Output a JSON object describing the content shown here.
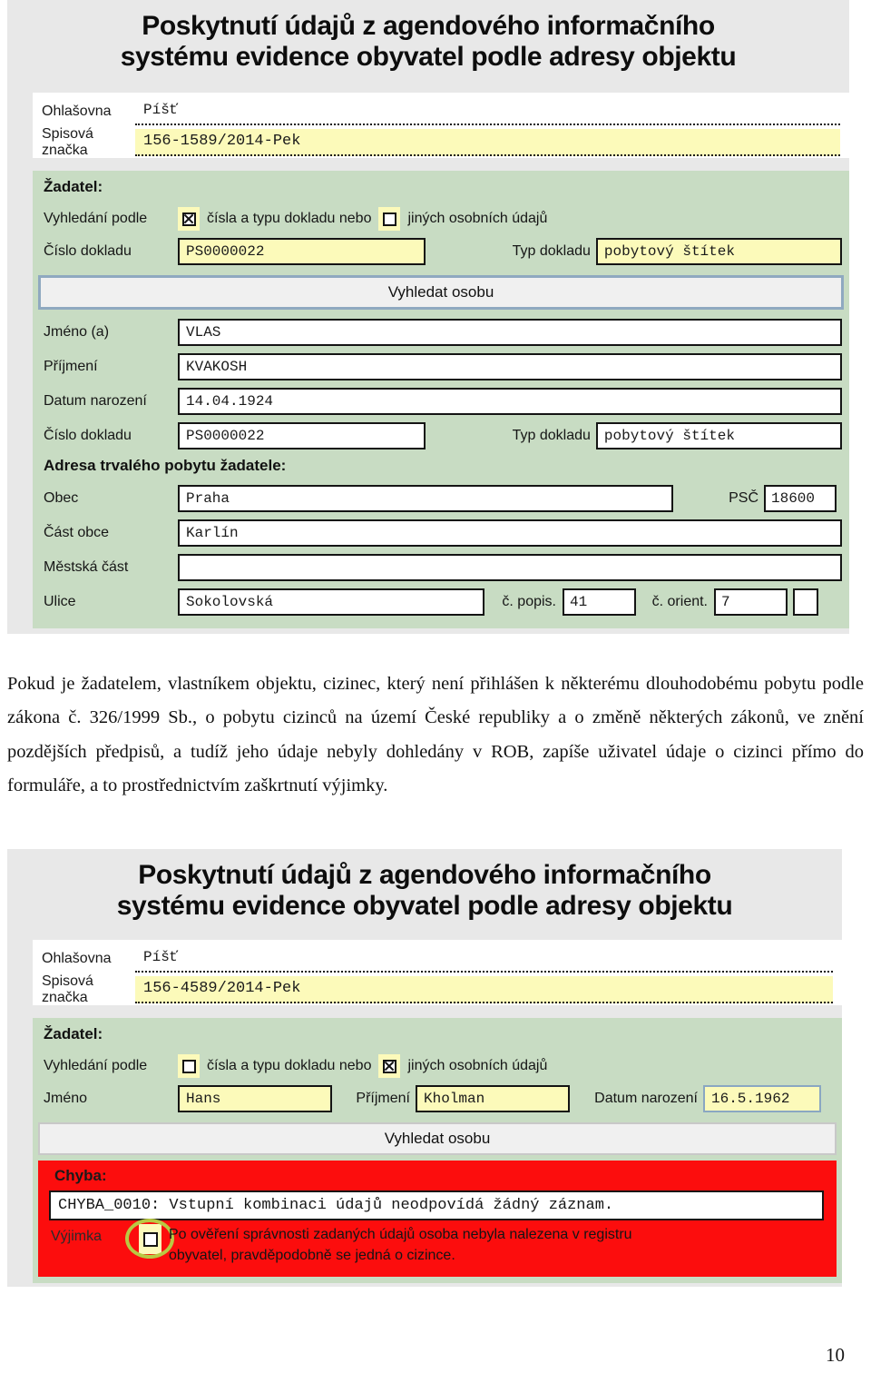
{
  "document": {
    "page_number": "10",
    "paragraph": "Pokud je žadatelem, vlastníkem objektu, cizinec, který není přihlášen k některému dlouhodobému pobytu podle zákona č. 326/1999 Sb., o pobytu cizinců na území České republiky a o změně některých zákonů, ve znění pozdějších předpisů, a tudíž jeho údaje nebyly dohledány v ROB, zapíše uživatel údaje o cizinci přímo do formuláře, a to prostřednictvím zaškrtnutí výjimky."
  },
  "colors": {
    "panel_green": "#c8dcc3",
    "field_yellow": "#fcfaba",
    "error_red": "#fc0d0d",
    "annotation_green": "#b9c943",
    "screenshot_gray": "#e8e8e8",
    "button_border_blue": "#8fa9c0"
  },
  "screenshot_1": {
    "title_line1": "Poskytnutí údajů z agendového informačního",
    "title_line2": "systému evidence obyvatel podle adresy objektu",
    "header": {
      "ohlasovna_label": "Ohlašovna",
      "ohlasovna_value": "Píšť",
      "spis_label": "Spisová značka",
      "spis_value": "156-1589/2014-Pek"
    },
    "applicant": {
      "section_label": "Žadatel:",
      "search_by_label": "Vyhledání podle",
      "option_doc_label": "čísla a typu dokladu nebo",
      "option_doc_checked": true,
      "option_other_label": "jiných osobních údajů",
      "option_other_checked": false,
      "doc_number_label": "Číslo dokladu",
      "doc_number_value": "PS0000022",
      "doc_type_label": "Typ dokladu",
      "doc_type_value": "pobytový štítek",
      "search_button_label": "Vyhledat osobu"
    },
    "person": {
      "first_name_label": "Jméno (a)",
      "first_name_value": "VLAS",
      "last_name_label": "Příjmení",
      "last_name_value": "KVAKOSH",
      "birth_label": "Datum narození",
      "birth_value": "14.04.1924",
      "doc_number_label": "Číslo dokladu",
      "doc_number_value": "PS0000022",
      "doc_type_label": "Typ dokladu",
      "doc_type_value": "pobytový štítek"
    },
    "address": {
      "section_label": "Adresa trvalého pobytu žadatele:",
      "city_label": "Obec",
      "city_value": "Praha",
      "zip_label": "PSČ",
      "zip_value": "18600",
      "city_part_label": "Část obce",
      "city_part_value": "Karlín",
      "district_label": "Městská část",
      "district_value": "",
      "street_label": "Ulice",
      "street_value": "Sokolovská",
      "cp_label": "č. popis.",
      "cp_value": "41",
      "co_label": "č. orient.",
      "co_value": "7",
      "extra_value": ""
    }
  },
  "screenshot_2": {
    "title_line1": "Poskytnutí údajů z agendového informačního",
    "title_line2": "systému evidence obyvatel podle adresy objektu",
    "header": {
      "ohlasovna_label": "Ohlašovna",
      "ohlasovna_value": "Píšť",
      "spis_label": "Spisová značka",
      "spis_value": "156-4589/2014-Pek"
    },
    "applicant": {
      "section_label": "Žadatel:",
      "search_by_label": "Vyhledání podle",
      "option_doc_label": "čísla a typu dokladu nebo",
      "option_doc_checked": false,
      "option_other_label": "jiných osobních údajů",
      "option_other_checked": true,
      "first_name_label": "Jméno",
      "first_name_value": "Hans",
      "last_name_label": "Příjmení",
      "last_name_value": "Kholman",
      "birth_label": "Datum narození",
      "birth_value": "16.5.1962",
      "search_button_label": "Vyhledat osobu"
    },
    "error": {
      "heading": "Chyba:",
      "message": "CHYBA_0010: Vstupní kombinaci údajů neodpovídá žádný záznam.",
      "exception_label": "Výjimka",
      "exception_checked": false,
      "exception_text_line1": "Po ověření správnosti zadaných údajů osoba nebyla nalezena v registru",
      "exception_text_line2": "obyvatel, pravděpodobně se jedná o cizince."
    }
  }
}
